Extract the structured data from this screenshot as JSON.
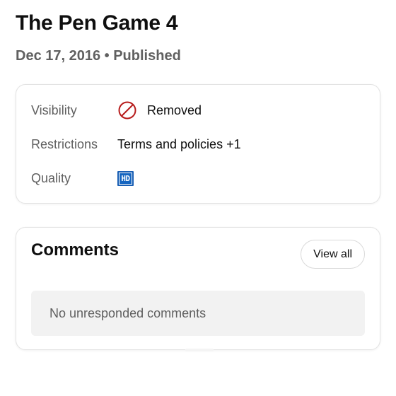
{
  "video": {
    "title": "The Pen Game 4",
    "date_status": "Dec 17, 2016 • Published"
  },
  "details": {
    "visibility": {
      "label": "Visibility",
      "value": "Removed",
      "icon": "removed-icon"
    },
    "restrictions": {
      "label": "Restrictions",
      "value": "Terms and policies +1"
    },
    "quality": {
      "label": "Quality",
      "badge": "HD",
      "icon": "hd-badge-icon"
    }
  },
  "comments": {
    "title": "Comments",
    "view_all_label": "View all",
    "empty_message": "No unresponded comments"
  },
  "colors": {
    "removed_icon": "#b71c1c",
    "hd_badge": "#1565c0",
    "secondary_text": "#606060",
    "empty_box_bg": "#f2f2f2"
  }
}
